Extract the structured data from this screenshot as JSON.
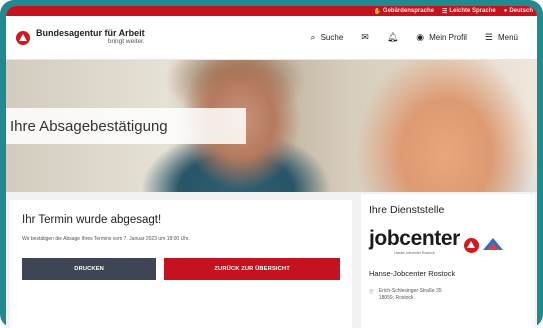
{
  "topbar": {
    "items": [
      {
        "icon": "hand-icon",
        "label": "Gebärdensprache"
      },
      {
        "icon": "easy-language-icon",
        "label": "Leichte Sprache"
      },
      {
        "icon": "language-icon",
        "label": "Deutsch"
      }
    ]
  },
  "header": {
    "logo_title": "Bundesagentur für Arbeit",
    "logo_subtitle": "bringt weiter.",
    "search_label": "Suche",
    "profile_label": "Mein Profil",
    "menu_label": "Menü"
  },
  "hero": {
    "title": "Ihre Absagebestätigung"
  },
  "main": {
    "heading": "Ihr Termin wurde abgesagt!",
    "text": "Wir bestätigen die Absage Ihres Termins vom 7. Januar 2023 um 18:00 Uhr.",
    "print_label": "DRUCKEN",
    "back_label": "ZURÜCK ZUR ÜBERSICHT"
  },
  "side": {
    "heading": "Ihre Dienststelle",
    "logo_word": "jobcenter",
    "logo_sub": "Hanse-Jobcenter Rostock",
    "name": "Hanse-Jobcenter Rostock",
    "street": "Erich-Schlesinger-Straße 35",
    "city": "18059, Rostock"
  },
  "colors": {
    "brand_red": "#c4131f",
    "frame_teal": "#1f8a8f",
    "button_dark": "#3e4656"
  }
}
